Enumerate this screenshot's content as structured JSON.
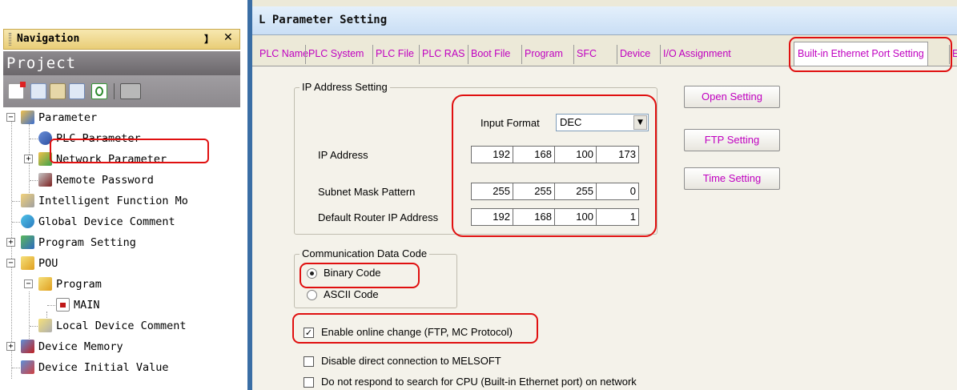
{
  "navigation": {
    "title": "Navigation",
    "pin_icon": "】",
    "close_icon": "✕",
    "project_title": "Project",
    "toolbar_icons": [
      "new-icon",
      "copy-icon",
      "paste-icon",
      "properties-icon",
      "refresh-icon",
      "filter-icon"
    ],
    "tree": [
      {
        "label": "Parameter",
        "expander": "−"
      },
      {
        "label": "PLC Parameter"
      },
      {
        "label": "Network Parameter",
        "expander": "+"
      },
      {
        "label": "Remote Password"
      },
      {
        "label": "Intelligent Function Mo"
      },
      {
        "label": "Global Device Comment"
      },
      {
        "label": "Program Setting",
        "expander": "+"
      },
      {
        "label": "POU",
        "expander": "−"
      },
      {
        "label": "Program",
        "expander": "−"
      },
      {
        "label": "MAIN"
      },
      {
        "label": "Local Device Comment"
      },
      {
        "label": "Device Memory",
        "expander": "+"
      },
      {
        "label": "Device Initial Value"
      }
    ]
  },
  "dialog": {
    "title": "L Parameter Setting",
    "tabs": [
      "PLC Name",
      "PLC System",
      "PLC File",
      "PLC RAS",
      "Boot File",
      "Program",
      "SFC",
      "Device",
      "I/O Assignment",
      "Built-in Ethernet Port Setting",
      "E"
    ],
    "active_tab": "Built-in Ethernet Port Setting",
    "ip_group": {
      "title": "IP Address Setting",
      "input_format_label": "Input Format",
      "input_format_value": "DEC",
      "ip_address_label": "IP Address",
      "ip_address": [
        "192",
        "168",
        "100",
        "173"
      ],
      "subnet_label": "Subnet Mask Pattern",
      "subnet": [
        "255",
        "255",
        "255",
        "0"
      ],
      "router_label": "Default Router IP Address",
      "router": [
        "192",
        "168",
        "100",
        "1"
      ]
    },
    "buttons": {
      "open_setting": "Open Setting",
      "ftp_setting": "FTP Setting",
      "time_setting": "Time Setting"
    },
    "comm_group": {
      "title": "Communication Data Code",
      "binary": "Binary Code",
      "ascii": "ASCII Code",
      "selected": "Binary Code"
    },
    "options": {
      "enable_online_change": {
        "label": "Enable online change (FTP, MC Protocol)",
        "checked": true,
        "mark": "✓"
      },
      "disable_direct": {
        "label": "Disable direct connection to MELSOFT",
        "checked": false
      },
      "no_respond": {
        "label": "Do not respond to search for CPU (Built-in Ethernet port) on network",
        "checked": false
      }
    }
  },
  "colors": {
    "highlight": "#e01010",
    "tab_text": "#c000c0"
  }
}
